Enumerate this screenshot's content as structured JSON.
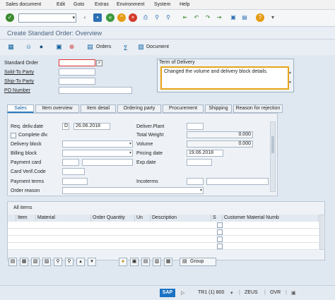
{
  "menu": [
    "Sales document",
    "Edit",
    "Goto",
    "Extras",
    "Environment",
    "System",
    "Help"
  ],
  "toolbar": {
    "command_value": "",
    "icons": [
      "check-icon",
      "save-icon",
      "back-icon",
      "exit-icon",
      "cancel-icon",
      "print-icon",
      "find-icon",
      "find-next-icon",
      "first-page-icon",
      "prev-page-icon",
      "next-page-icon",
      "last-page-icon",
      "create-session-icon",
      "shortcut-icon",
      "help-icon",
      "customize-icon"
    ]
  },
  "title": "Create Standard Order: Overview",
  "toolbar2": {
    "orders": "Orders",
    "document": "Document",
    "sigma": "Σ"
  },
  "header": {
    "standard_order_label": "Standard Order",
    "standard_order_value": "",
    "sold_to_label": "Sold-To Party",
    "ship_to_label": "Ship-To Party",
    "po_number_label": "PO Number",
    "term_title": "Term of Delivery",
    "term_text": "Changed the volume and delivery block details."
  },
  "tabs": [
    "Sales",
    "Item overview",
    "Item detail",
    "Ordering party",
    "Procurement",
    "Shipping",
    "Reason for rejection"
  ],
  "sales": {
    "req_deliv_label": "Req. deliv.date",
    "req_deliv_type": "D",
    "req_deliv_value": "26.06.2018",
    "complete_label": "Complete dlv.",
    "delivery_block_label": "Delivery block",
    "billing_block_label": "Billing block",
    "payment_card_label": "Payment card",
    "card_verif_label": "Card Verif.Code",
    "payment_terms_label": "Payment terms",
    "order_reason_label": "Order reason",
    "deliver_plant_label": "Deliver.Plant",
    "total_weight_label": "Total Weight",
    "total_weight_value": "0.000",
    "volume_label": "Volume",
    "volume_value": "0.000",
    "pricing_date_label": "Pricing date",
    "pricing_date_value": "19.06.2018",
    "exp_date_label": "Exp.date",
    "incoterms_label": "Incoterms"
  },
  "items": {
    "title": "All items",
    "columns": [
      "Item",
      "Material",
      "Order Quantity",
      "Un",
      "Description",
      "S",
      "Customer Material Numb"
    ],
    "group_label": "Group"
  },
  "status": {
    "session": "TR1 (1) 800",
    "server": "ZEUS",
    "mode": "OVR",
    "brand": "SAP"
  }
}
